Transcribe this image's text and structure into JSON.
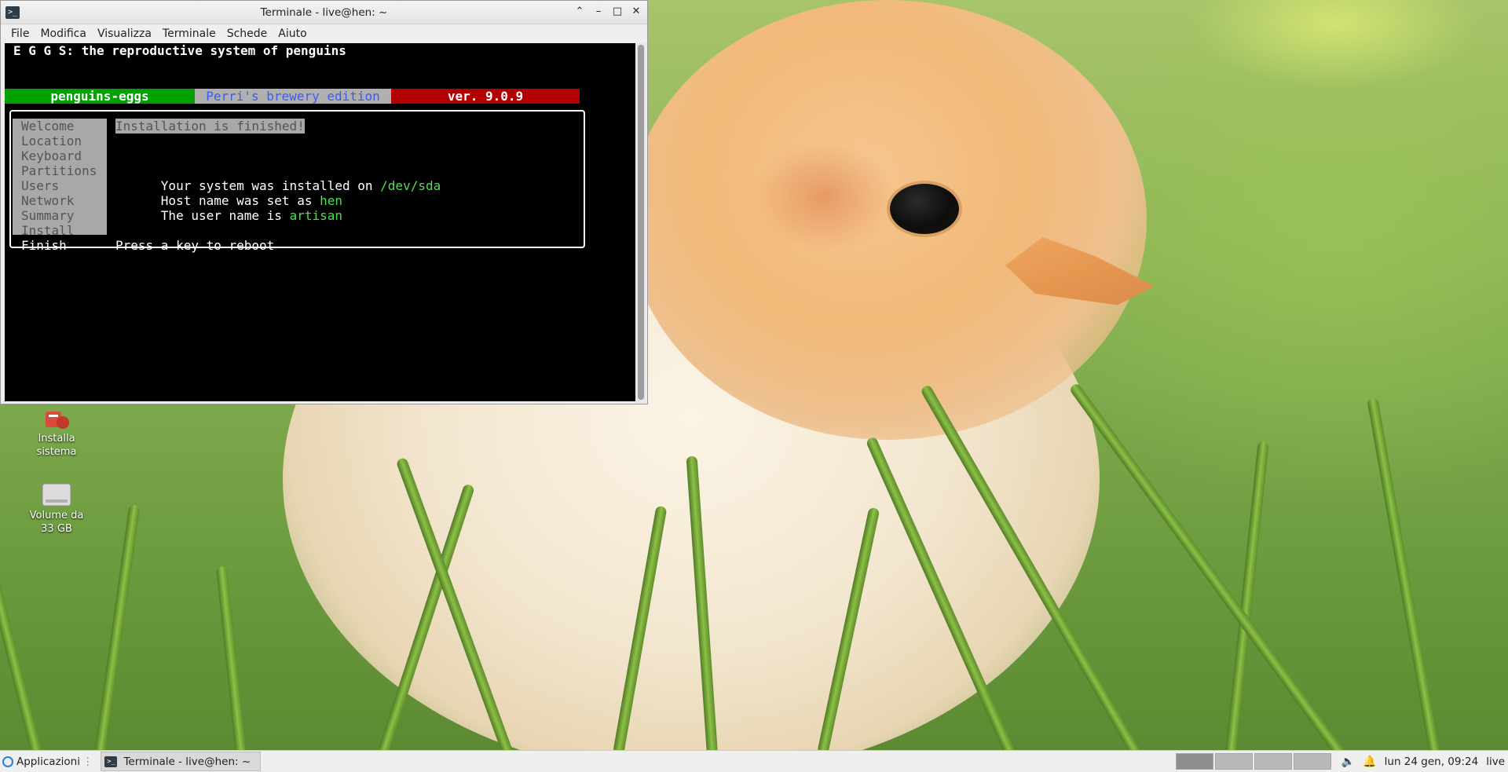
{
  "desktop": {
    "icons": [
      {
        "label_line1": "Installa",
        "label_line2": "sistema",
        "icon": "installer-icon"
      },
      {
        "label_line1": "Volume da",
        "label_line2": "33 GB",
        "icon": "drive-icon"
      }
    ]
  },
  "terminal": {
    "window_title": "Terminale - live@hen: ~",
    "menu": [
      "File",
      "Modifica",
      "Visualizza",
      "Terminale",
      "Schede",
      "Aiuto"
    ],
    "header_line": "E G G S: the reproductive system of penguins",
    "badges": {
      "name": "penguins-eggs",
      "edition": "Perri's brewery edition",
      "version": "ver. 9.0.9",
      "name_color": "#00a000",
      "edition_color": "#b0b0b0",
      "edition_text_color": "#3a5cf0",
      "version_color": "#b20000"
    },
    "steps": [
      "Welcome",
      "Location",
      "Keyboard",
      "Partitions",
      "Users",
      "Network",
      "Summary",
      "Install",
      "Finish"
    ],
    "active_step": "Finish",
    "content": {
      "heading": "Installation is finished!",
      "line1_prefix": "Your system was installed on ",
      "line1_value": "/dev/sda",
      "line2_prefix": "Host name was set as ",
      "line2_value": "hen",
      "line3_prefix": "The user name is ",
      "line3_value": "artisan",
      "footer": "Press a key to reboot"
    }
  },
  "taskbar": {
    "apps_label": "Applicazioni",
    "task_label": "Terminale - live@hen: ~",
    "clock": "lun 24 gen, 09:24",
    "user": "live"
  }
}
